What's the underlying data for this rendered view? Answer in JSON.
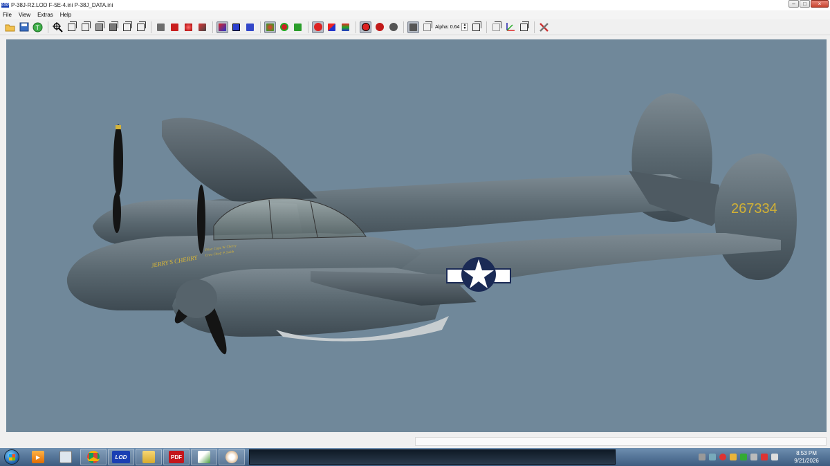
{
  "window": {
    "app_icon_text": "LOD",
    "title": "P-38J-R2.LOD  F-5E-4.ini  P-38J_DATA.ini",
    "controls": [
      "–",
      "□",
      "×"
    ]
  },
  "menu": [
    "File",
    "View",
    "Extras",
    "Help"
  ],
  "toolbar": {
    "alpha_label": "Alpha: 0.64",
    "icons": [
      "open-icon",
      "save-icon",
      "texture-icon",
      "zoom-fit-icon",
      "view-front-icon",
      "view-back-icon",
      "view-left-icon",
      "view-right-icon",
      "view-top-icon",
      "view-bottom-icon",
      "solid-grey-icon",
      "solid-red-icon",
      "solid-red-shaded-icon",
      "solid-red-dark-icon",
      "select-all-icon",
      "select-box-icon",
      "select-face-icon",
      "green-object-icon",
      "green-ring-icon",
      "green-solid-icon",
      "red-paint-icon",
      "multicolor-cube-icon",
      "color-cube-icon",
      "ladybug-icon",
      "apple-icon",
      "bomb-icon",
      "alpha-cube-icon",
      "wire-box-icon",
      "box-transparent-icon",
      "axes-icon",
      "box-outline-icon",
      "tools-icon"
    ]
  },
  "viewport": {
    "background": "#70889a",
    "aircraft": {
      "nose_art": "JERRY'S CHERRY",
      "serial": "267334",
      "side_text_1": "Pilot: Capt. W. Cherry",
      "side_text_2": "Crew Chief: P. Smith",
      "colors": {
        "body": "#5b6a73",
        "serial_color": "#d2b135",
        "star": "#1a2a55"
      }
    }
  },
  "taskbar": {
    "items": [
      {
        "name": "media-player-icon",
        "label": ""
      },
      {
        "name": "notepad-icon",
        "label": ""
      },
      {
        "name": "chrome-icon",
        "label": ""
      },
      {
        "name": "lod-app-icon",
        "label": "LOD"
      },
      {
        "name": "explorer-icon",
        "label": ""
      },
      {
        "name": "pdf-icon",
        "label": "PDF"
      },
      {
        "name": "editor-icon",
        "label": ""
      },
      {
        "name": "paint-icon",
        "label": ""
      }
    ],
    "clock_time": "8:53 PM",
    "clock_date": "9/21/2026"
  }
}
